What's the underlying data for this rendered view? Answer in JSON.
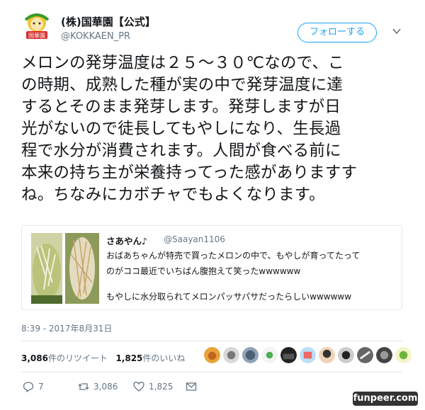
{
  "tweet": {
    "display_name": "(株)国華園【公式】",
    "handle": "@KOKKAEN_PR",
    "avatar_badge": "国華園",
    "follow_label": "フォローする",
    "text_lines": [
      "メロンの発芽温度は２５～３０℃なので、こ",
      "の時期、成熟した種が実の中で発芽温度に達",
      "するとそのまま発芽します。発芽しますが日",
      "光がないので徒長してもやしになり、生長過",
      "程で水分が消費されます。人間が食べる前に",
      "本来の持ち主が栄養持ってった感がありますす",
      "ね。ちなみにカボチャでもよくなります。"
    ],
    "timestamp": "8:39 - 2017年8月31日"
  },
  "quote": {
    "name": "さあやん♪",
    "handle": "@Saayan1106",
    "lines": [
      "おばあちゃんが特売で買ったメロンの中で、もやしが育ってたって",
      "のがココ最近でいちばん腹抱えて笑ったwwwwww",
      "もやしに水分取られてメロンパッサパサだったらしいwwwwww"
    ]
  },
  "stats": {
    "retweets_count": "3,086",
    "retweets_label": "件のリツイート",
    "likes_count": "1,825",
    "likes_label": "件のいいね"
  },
  "actions": {
    "reply_count": "7",
    "retweet_count": "3,086",
    "like_count": "1,825"
  },
  "watermark": "funpeer.com",
  "colors": {
    "accent": "#1da1f2",
    "muted": "#657786",
    "border": "#e1e8ed"
  }
}
